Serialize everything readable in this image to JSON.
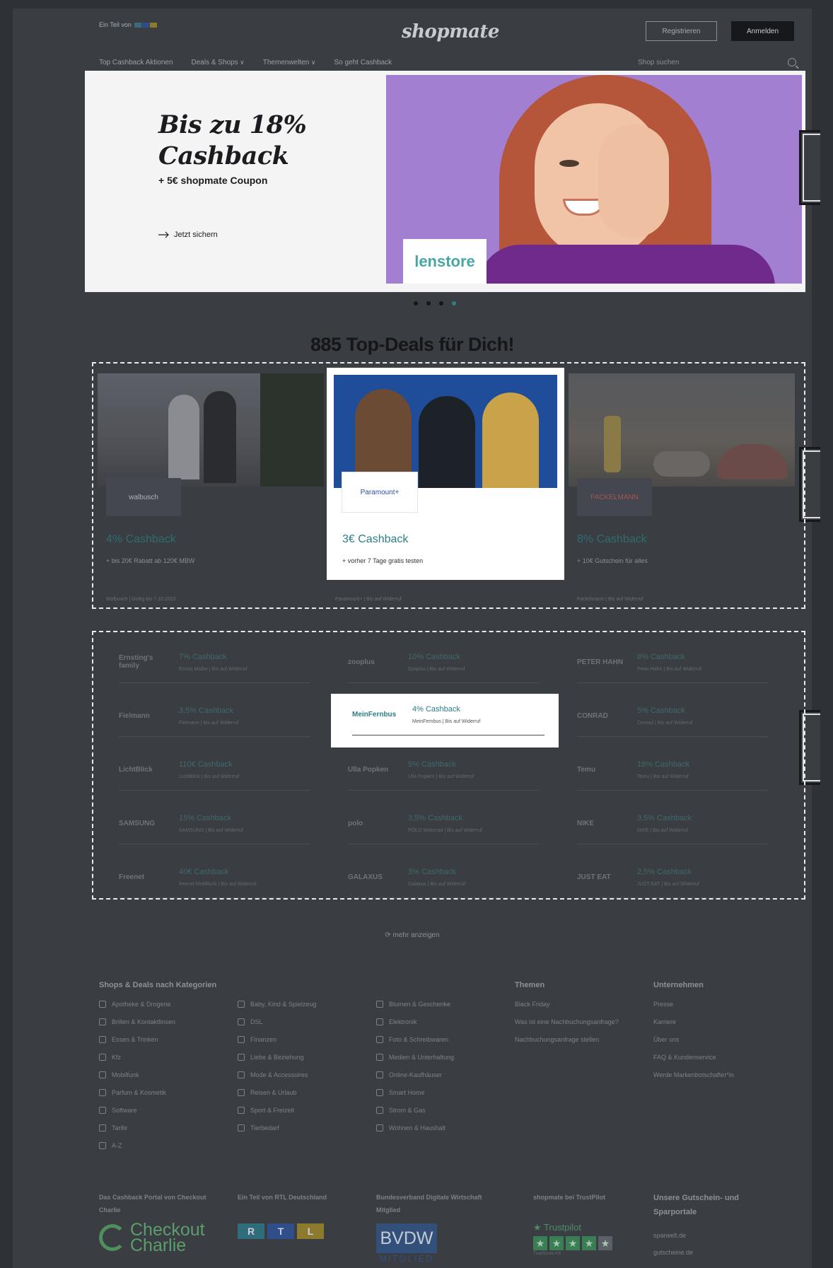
{
  "header": {
    "teil_label": "Ein Teil von",
    "logo": "shopmate",
    "register_label": "Registrieren",
    "login_label": "Anmelden",
    "nav": [
      "Top Cashback Aktionen",
      "Deals & Shops",
      "Themenwelten",
      "So geht Cashback"
    ],
    "search_placeholder": "Shop suchen"
  },
  "hero": {
    "headline_line1": "Bis zu 18%",
    "headline_line2": "Cashback",
    "subline": "+ 5€ shopmate Coupon",
    "cta": "Jetzt sichern",
    "brand": "lenstore",
    "slides_total": 4,
    "active_slide": 4
  },
  "deals": {
    "title": "885 Top-Deals für Dich!",
    "cards": [
      {
        "logo": "walbusch",
        "cashback": "4% Cashback",
        "sub": "+ bis 20€ Rabatt ab 120€ MBW",
        "legal": "Walbusch | Gültig bis 7.10.2023",
        "highlight": false
      },
      {
        "logo": "Paramount+",
        "cashback": "3€ Cashback",
        "sub": "+ vorher 7 Tage gratis testen",
        "legal": "Paramount+ | Bis auf Widerruf",
        "highlight": true
      },
      {
        "logo": "FACKELMANN",
        "cashback": "8% Cashback",
        "sub": "+ 10€ Gutschein für alles",
        "legal": "Fackelmann | Bis auf Widerruf",
        "highlight": false
      }
    ]
  },
  "shops": [
    {
      "logo": "Ernsting's family",
      "cashback": "7% Cashback",
      "sub": "Ernsts Müller | Bis auf Widerruf",
      "highlight": false
    },
    {
      "logo": "zooplus",
      "cashback": "10% Cashback",
      "sub": "Zooplus | Bis auf Widerruf",
      "highlight": false
    },
    {
      "logo": "PETER HAHN",
      "cashback": "8% Cashback",
      "sub": "Peter Hahn | Bis auf Widerruf",
      "highlight": false
    },
    {
      "logo": "Fielmann",
      "cashback": "3,5% Cashback",
      "sub": "Fielmann | Bis auf Widerruf",
      "highlight": false
    },
    {
      "logo": "MeinFernbus",
      "cashback": "4% Cashback",
      "sub": "MeinFernbus | Bis auf Widerruf",
      "highlight": true
    },
    {
      "logo": "CONRAD",
      "cashback": "5% Cashback",
      "sub": "Conrad | Bis auf Widerruf",
      "highlight": false
    },
    {
      "logo": "LichtBlick",
      "cashback": "110€ Cashback",
      "sub": "LichtBlick | Bis auf Widerruf",
      "highlight": false
    },
    {
      "logo": "Ulla Popken",
      "cashback": "5% Cashback",
      "sub": "Ulla Popken | Bis auf Widerruf",
      "highlight": false
    },
    {
      "logo": "Temu",
      "cashback": "18% Cashback",
      "sub": "Temu | Bis auf Widerruf",
      "highlight": false
    },
    {
      "logo": "SAMSUNG",
      "cashback": "15% Cashback",
      "sub": "SAMSUNG | Bis auf Widerruf",
      "highlight": false
    },
    {
      "logo": "polo",
      "cashback": "3,5% Cashback",
      "sub": "POLO Motorrad | Bis auf Widerruf",
      "highlight": false
    },
    {
      "logo": "NIKE",
      "cashback": "3,5% Cashback",
      "sub": "NIKE | Bis auf Widerruf",
      "highlight": false
    },
    {
      "logo": "Freenet",
      "cashback": "40€ Cashback",
      "sub": "freenet Mobilfunk | Bis auf Widerruf",
      "highlight": false
    },
    {
      "logo": "GALAXUS",
      "cashback": "3% Cashback",
      "sub": "Galaxus | Bis auf Widerruf",
      "highlight": false
    },
    {
      "logo": "JUST EAT",
      "cashback": "2,5% Cashback",
      "sub": "JUST EAT | Bis auf Widerruf",
      "highlight": false
    }
  ],
  "more_label": "mehr anzeigen",
  "footer": {
    "categories_title": "Shops & Deals nach Kategorien",
    "col1": [
      "Apotheke & Drogerie",
      "Brillen & Kontaktlinsen",
      "Essen & Trinken",
      "Kfz",
      "Mobilfunk",
      "Parfum & Kosmetik",
      "Software",
      "Tarife",
      "A-Z"
    ],
    "col2": [
      "Baby, Kind & Spielzeug",
      "DSL",
      "Finanzen",
      "Liebe & Beziehung",
      "Mode & Accessoires",
      "Reisen & Urlaub",
      "Sport & Freizeit",
      "Tierbedarf"
    ],
    "col3": [
      "Blumen & Geschenke",
      "Elektronik",
      "Foto & Schreibwaren",
      "Medien & Unterhaltung",
      "Online-Kaufhäuser",
      "Smart Home",
      "Strom & Gas",
      "Wohnen & Haushalt"
    ],
    "themen_title": "Themen",
    "themen": [
      "Black Friday",
      "Was ist eine Nachbuchungsanfrage?",
      "Nachbuchungsanfrage stellen"
    ],
    "unternehmen_title": "Unternehmen",
    "unternehmen": [
      "Presse",
      "Karriere",
      "Über uns",
      "FAQ & Kundenservice",
      "Werde Markenbotschafter*in"
    ],
    "partner1": "Das Cashback Portal von Checkout Charlie",
    "partner2": "Ein Teil von RTL Deutschland",
    "partner3": "Bundesverband Digitale Wirtschaft Mitglied",
    "partner4": "shopmate bei TrustPilot",
    "partner5": "Unsere Gutschein- und Sparportale",
    "checkout_line1": "Checkout",
    "checkout_line2": "Charlie",
    "rtl": [
      "R",
      "T",
      "L"
    ],
    "bvdw": "BVDW",
    "bvdw_sub": "MITGLIED",
    "trustpilot": "Trustpilot",
    "trust_score": "TrustScore 4,6",
    "portals": [
      "sparwelt.de",
      "gutscheine.de"
    ]
  }
}
